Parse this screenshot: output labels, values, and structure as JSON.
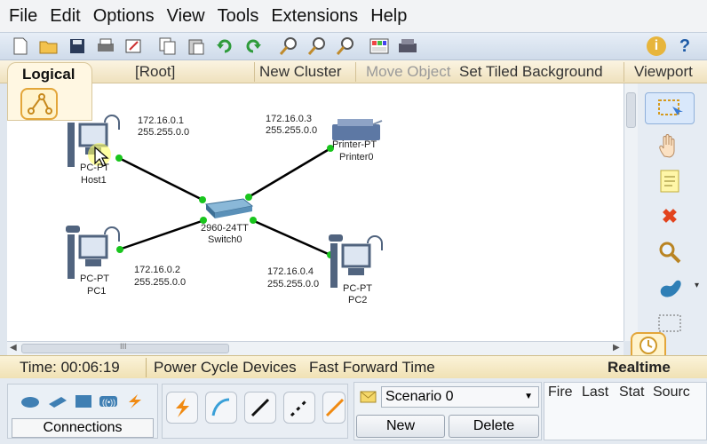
{
  "menu": [
    "File",
    "Edit",
    "Options",
    "View",
    "Tools",
    "Extensions",
    "Help"
  ],
  "toolbar": {
    "icons": [
      "new-file-icon",
      "open-folder-icon",
      "save-icon",
      "print-icon",
      "activity-wizard-icon",
      "copy-icon",
      "paste-icon",
      "undo-icon",
      "redo-icon",
      "zoom-in-icon",
      "zoom-reset-icon",
      "zoom-out-icon",
      "palette-icon",
      "custom-device-icon"
    ],
    "info_label": "i",
    "help_label": "?"
  },
  "workspace_nav": {
    "logical": "Logical",
    "root": "[Root]",
    "new_cluster": "New Cluster",
    "move_object": "Move Object",
    "set_tiled_background": "Set Tiled Background",
    "viewport": "Viewport"
  },
  "topology": {
    "devices": [
      {
        "model": "PC-PT",
        "name": "Host1",
        "ip": "172.16.0.1",
        "mask": "255.255.0.0"
      },
      {
        "model": "Printer-PT",
        "name": "Printer0",
        "ip": "172.16.0.3",
        "mask": "255.255.0.0"
      },
      {
        "model": "2960-24TT",
        "name": "Switch0"
      },
      {
        "model": "PC-PT",
        "name": "PC1",
        "ip": "172.16.0.2",
        "mask": "255.255.0.0"
      },
      {
        "model": "PC-PT",
        "name": "PC2",
        "ip": "172.16.0.4",
        "mask": "255.255.0.0"
      }
    ]
  },
  "hscroll_marker": "III",
  "right_tools": [
    "select-icon",
    "hand-icon",
    "note-icon",
    "delete-icon",
    "inspect-icon",
    "draw-shape-icon",
    "resize-icon"
  ],
  "status": {
    "time_label": "Time: 00:06:19",
    "power_cycle": "Power Cycle Devices",
    "fast_forward": "Fast Forward Time",
    "mode": "Realtime"
  },
  "bottom": {
    "category_label": "Connections",
    "scenario": "Scenario 0",
    "new_button": "New",
    "delete_button": "Delete",
    "event_columns": [
      "Fire",
      "Last",
      "Stat",
      "Sourc"
    ]
  },
  "colors": {
    "link_dot": "#19c51d",
    "accent": "#e3a63a"
  }
}
